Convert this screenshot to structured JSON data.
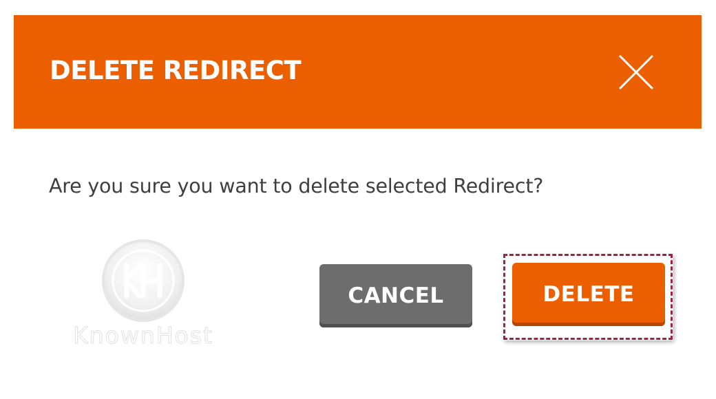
{
  "dialog": {
    "title": "DELETE REDIRECT",
    "message": "Are you sure you want to delete selected Redirect?",
    "close_icon": "close-icon",
    "buttons": {
      "cancel_label": "CANCEL",
      "delete_label": "DELETE"
    }
  },
  "watermark": {
    "text": "KnownHost",
    "logo_icon": "knownhost-logo-icon"
  },
  "colors": {
    "accent": "#ec5f00",
    "cancel_button": "#6d6d6d",
    "highlight_outline": "#a3213b"
  }
}
